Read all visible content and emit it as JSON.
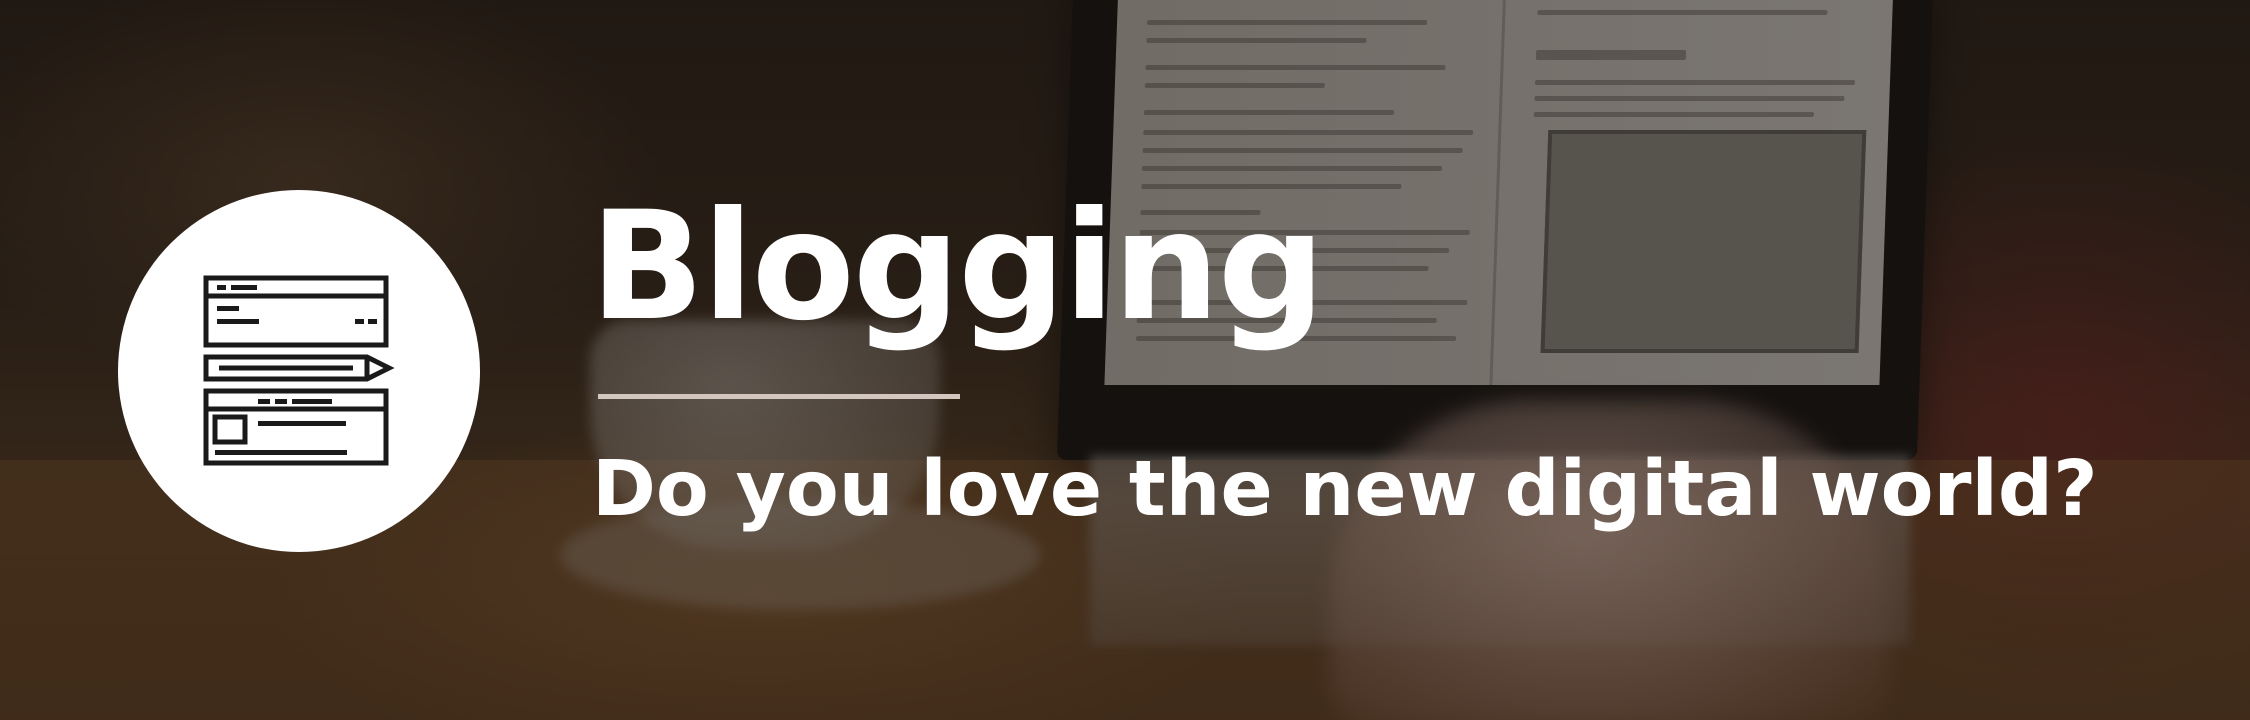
{
  "banner": {
    "title": "Blogging",
    "subtitle": "Do you love the new digital world?",
    "icon": "blog-editor-pencil-icon",
    "colors": {
      "text": "#ffffff",
      "circle": "#ffffff",
      "icon": "#1a1a1a",
      "divider": "#d2c6be"
    }
  }
}
